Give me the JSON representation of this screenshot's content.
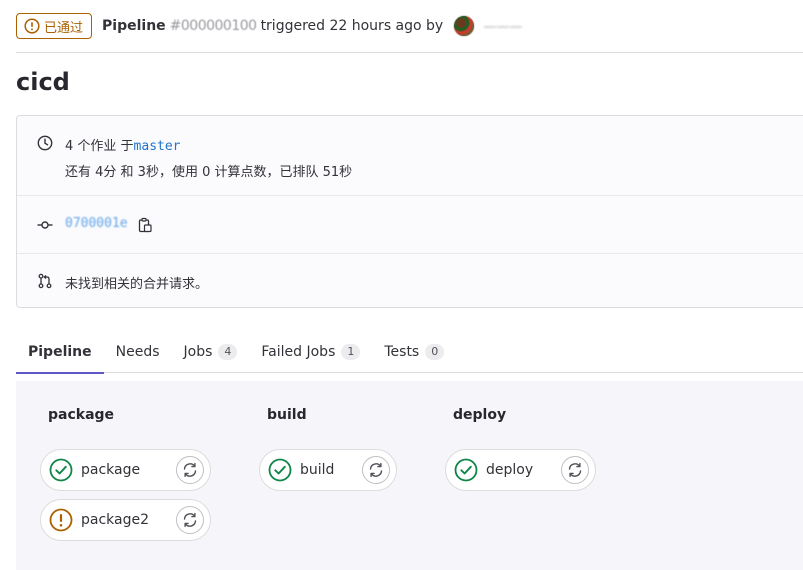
{
  "header": {
    "status_badge": "已通过",
    "pipeline_label": "Pipeline",
    "pipeline_id": "#000000100",
    "triggered_text": "triggered 22 hours ago by",
    "username": "一一一"
  },
  "page_title": "cicd",
  "info": {
    "jobs_text": "4 个作业 于",
    "branch": "master",
    "duration_text": "还有 4分 和 3秒，使用 0 计算点数，已排队 51秒",
    "commit_sha": "0700001e",
    "merge_request_text": "未找到相关的合并请求。"
  },
  "tabs": [
    {
      "label": "Pipeline",
      "count": null,
      "active": true
    },
    {
      "label": "Needs",
      "count": null,
      "active": false
    },
    {
      "label": "Jobs",
      "count": "4",
      "active": false
    },
    {
      "label": "Failed Jobs",
      "count": "1",
      "active": false
    },
    {
      "label": "Tests",
      "count": "0",
      "active": false
    }
  ],
  "stages": [
    {
      "name": "package",
      "jobs": [
        {
          "name": "package",
          "status": "success"
        },
        {
          "name": "package2",
          "status": "warning"
        }
      ]
    },
    {
      "name": "build",
      "jobs": [
        {
          "name": "build",
          "status": "success"
        }
      ]
    },
    {
      "name": "deploy",
      "jobs": [
        {
          "name": "deploy",
          "status": "success"
        }
      ]
    }
  ],
  "colors": {
    "success": "#108548",
    "warning": "#ab6100",
    "link": "#1f75cb",
    "tab_active": "#5f57c3"
  }
}
